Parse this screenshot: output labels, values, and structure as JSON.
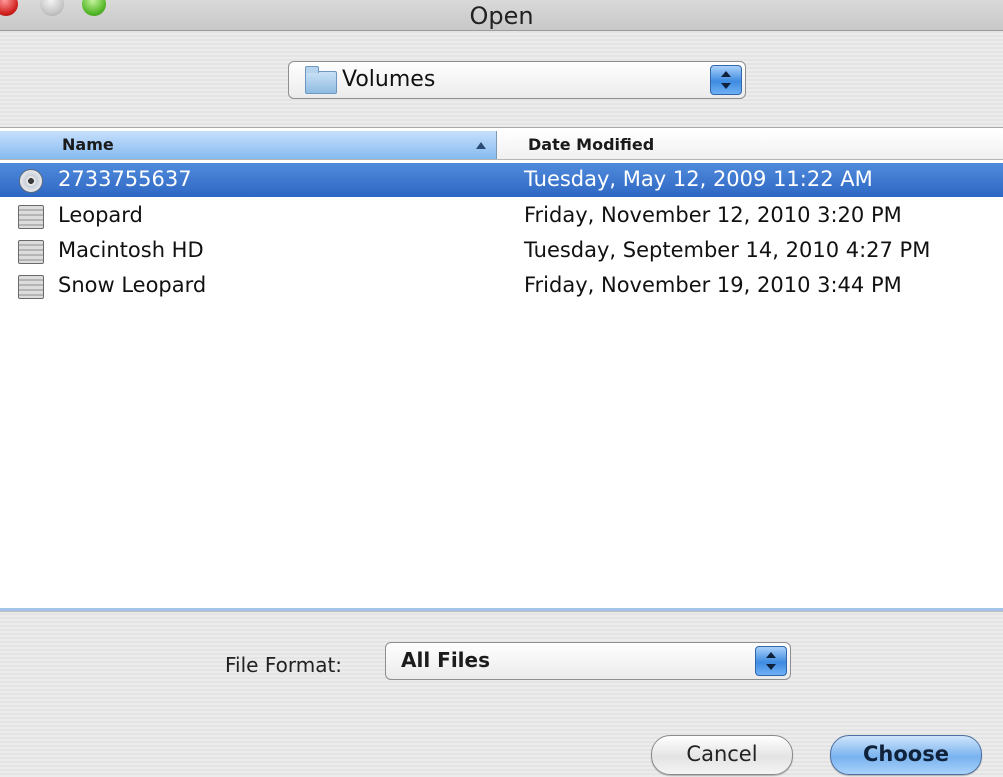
{
  "window": {
    "title": "Open"
  },
  "location": {
    "selected": "Volumes",
    "icon": "folder-icon"
  },
  "columns": {
    "name": "Name",
    "date": "Date Modified"
  },
  "files": [
    {
      "name": "2733755637",
      "date": "Tuesday, May 12, 2009 11:22 AM",
      "icon": "cd-icon",
      "selected": true
    },
    {
      "name": "Leopard",
      "date": "Friday, November 12, 2010 3:20 PM",
      "icon": "disk-icon",
      "selected": false
    },
    {
      "name": "Macintosh HD",
      "date": "Tuesday, September 14, 2010 4:27 PM",
      "icon": "disk-icon",
      "selected": false
    },
    {
      "name": "Snow Leopard",
      "date": "Friday, November 19, 2010 3:44 PM",
      "icon": "disk-icon",
      "selected": false
    }
  ],
  "format": {
    "label": "File Format:",
    "value": "All Files"
  },
  "buttons": {
    "cancel": "Cancel",
    "choose": "Choose"
  },
  "colors": {
    "selection": "#3a74cc",
    "accent": "#6fb0f5"
  }
}
